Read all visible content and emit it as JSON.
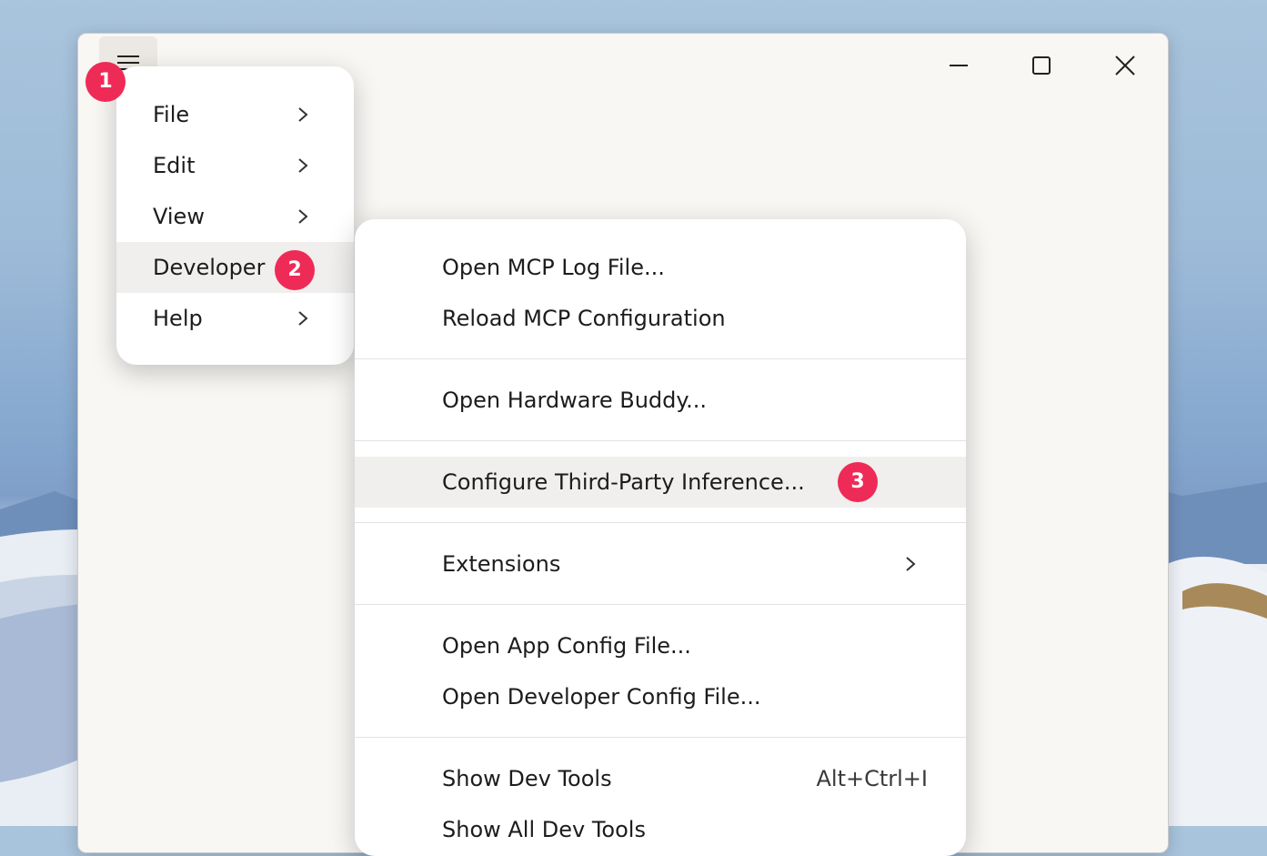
{
  "window": {
    "menu_button_icon": "hamburger-menu-icon",
    "controls": [
      "minimize-icon",
      "maximize-icon",
      "close-icon"
    ]
  },
  "badges": {
    "one": "1",
    "two": "2",
    "three": "3"
  },
  "menu": {
    "items": [
      {
        "label": "File",
        "has_submenu": true
      },
      {
        "label": "Edit",
        "has_submenu": true
      },
      {
        "label": "View",
        "has_submenu": true
      },
      {
        "label": "Developer",
        "has_submenu": true,
        "active": true
      },
      {
        "label": "Help",
        "has_submenu": true
      }
    ]
  },
  "developer_menu": {
    "open_mcp_log": "Open MCP Log File...",
    "reload_mcp": "Reload MCP Configuration",
    "hardware_buddy": "Open Hardware Buddy...",
    "third_party": "Configure Third-Party Inference...",
    "extensions": "Extensions",
    "app_config": "Open App Config File...",
    "dev_config": "Open Developer Config File...",
    "dev_tools": "Show Dev Tools",
    "dev_tools_shortcut": "Alt+Ctrl+I",
    "all_dev_tools": "Show All Dev Tools"
  },
  "colors": {
    "badge": "#ee2b56",
    "window_bg": "#f9f7f4",
    "hover": "#f0efed"
  }
}
